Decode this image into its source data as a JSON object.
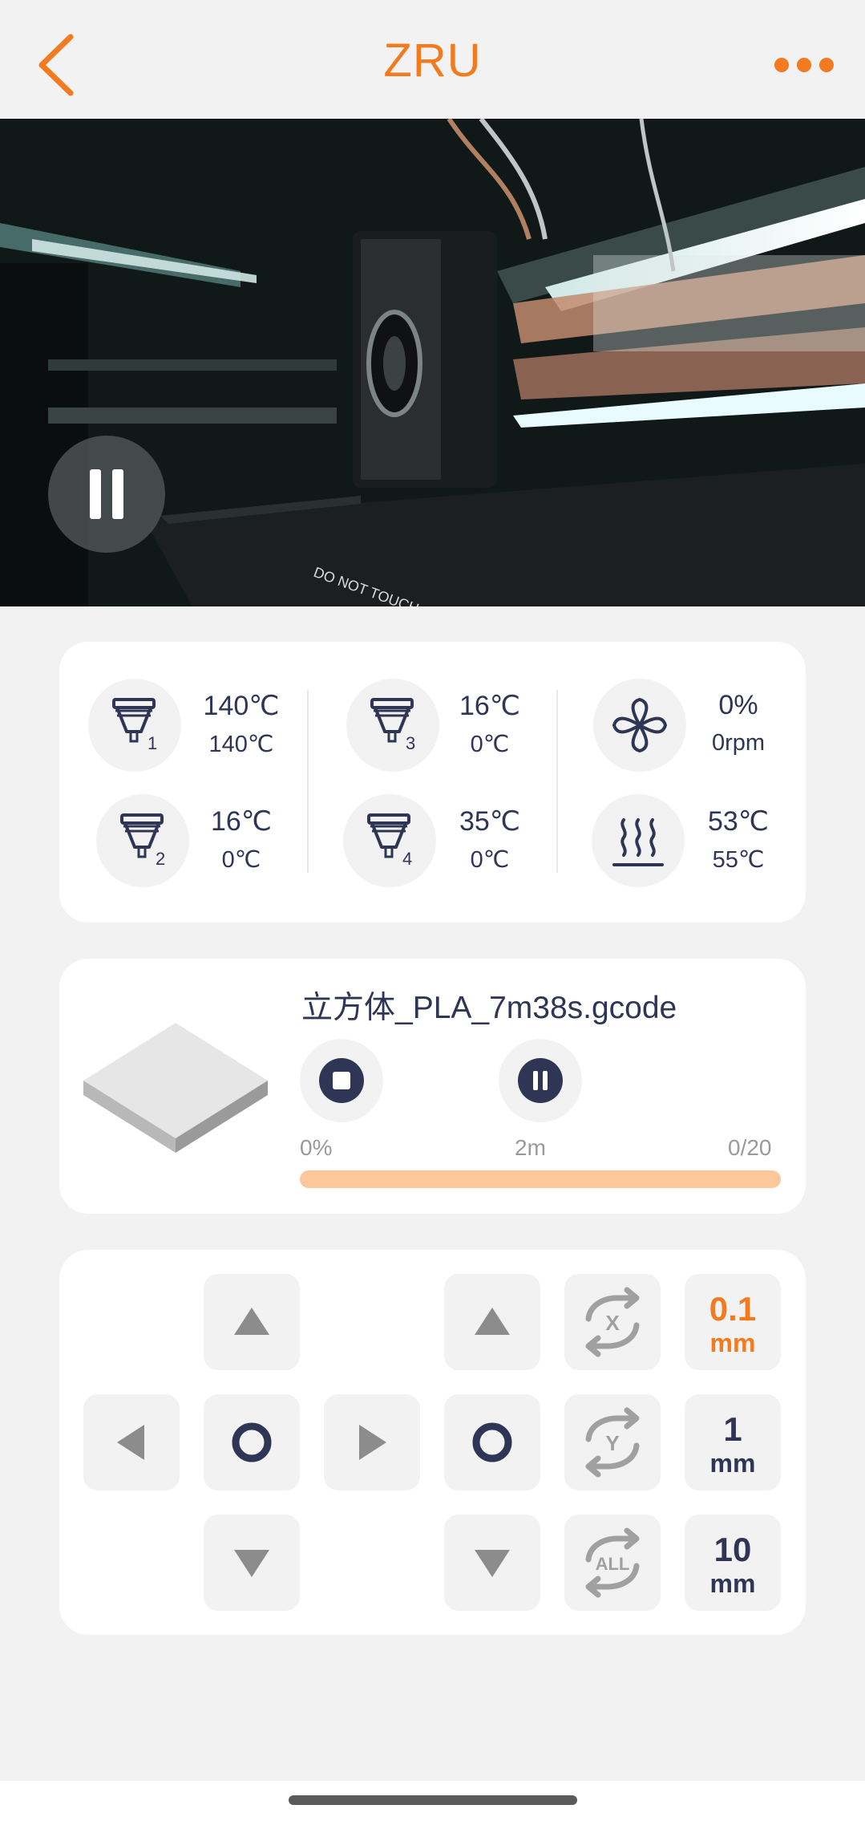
{
  "header": {
    "title": "ZRU",
    "back_icon": "chevron-left-icon",
    "more_icon": "more-horizontal-icon",
    "accent_color": "#f27a1f"
  },
  "camera": {
    "pause_icon": "pause-icon",
    "printed_text": "DO NOT TOUCH"
  },
  "temperatures": {
    "extruders": [
      {
        "index": "1",
        "current": "140℃",
        "target": "140℃",
        "icon": "nozzle-icon"
      },
      {
        "index": "2",
        "current": "16℃",
        "target": "0℃",
        "icon": "nozzle-icon"
      },
      {
        "index": "3",
        "current": "16℃",
        "target": "0℃",
        "icon": "nozzle-icon"
      },
      {
        "index": "4",
        "current": "35℃",
        "target": "0℃",
        "icon": "nozzle-icon"
      }
    ],
    "fan": {
      "percent": "0%",
      "rpm": "0rpm",
      "icon": "fan-icon"
    },
    "bed": {
      "current": "53℃",
      "target": "55℃",
      "icon": "heated-bed-icon"
    }
  },
  "print_job": {
    "filename": "立方体_PLA_7m38s.gcode",
    "progress_label": "0%",
    "time_label": "2m",
    "layers_label": "0/20",
    "progress_fraction": 0,
    "stop_icon": "stop-icon",
    "pause_icon": "pause-icon"
  },
  "motion": {
    "xy_up_icon": "arrow-up-icon",
    "xy_down_icon": "arrow-down-icon",
    "xy_left_icon": "arrow-left-icon",
    "xy_right_icon": "arrow-right-icon",
    "xy_home_icon": "home-circle-icon",
    "z_up_icon": "arrow-up-icon",
    "z_down_icon": "arrow-down-icon",
    "z_home_icon": "home-circle-icon",
    "home_x_label": "X",
    "home_y_label": "Y",
    "home_all_label": "ALL",
    "steps": [
      {
        "value": "0.1",
        "unit": "mm",
        "selected": true
      },
      {
        "value": "1",
        "unit": "mm",
        "selected": false
      },
      {
        "value": "10",
        "unit": "mm",
        "selected": false
      }
    ]
  }
}
